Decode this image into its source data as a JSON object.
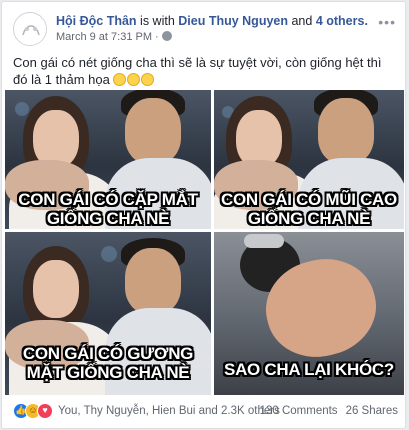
{
  "post": {
    "author": "Hội Độc Thân",
    "with_text": "is with",
    "tagged_user": "Dieu Thuy Nguyen",
    "and_text": "and",
    "others_link": "4 others.",
    "timestamp": "March 9 at 7:31 PM",
    "separator": "·",
    "privacy_icon": "globe-icon",
    "more_icon": "more-options-icon",
    "more_glyph": "•••",
    "caption": "Con gái có nét giống cha thì sẽ là sự tuyệt vời, còn giống hệt thì đó là 1 thảm họa",
    "caption_emojis": [
      "grinning-face-emoji",
      "grinning-face-emoji",
      "grinning-face-emoji"
    ]
  },
  "meme": {
    "panel1": [
      "CON GÁI CÓ CẶP MẮT",
      "GIỐNG CHA NÈ"
    ],
    "panel2": [
      "CON GÁI CÓ MŨI CAO",
      "GIỐNG CHA NÈ"
    ],
    "panel3": [
      "CON GÁI CÓ GƯƠNG",
      "MẶT GIỐNG CHA NÈ"
    ],
    "panel4": [
      "SAO CHA LẠI KHÓC?"
    ]
  },
  "footer": {
    "reactions": [
      "like-icon",
      "haha-icon",
      "love-icon"
    ],
    "reactors": "You, Thy Nguyễn, Hien Bui and 2.3K others",
    "comments": "130 Comments",
    "shares": "26 Shares"
  },
  "colors": {
    "link": "#365899",
    "like": "#1877f2",
    "love": "#f33e58",
    "haha": "#f7b928"
  }
}
